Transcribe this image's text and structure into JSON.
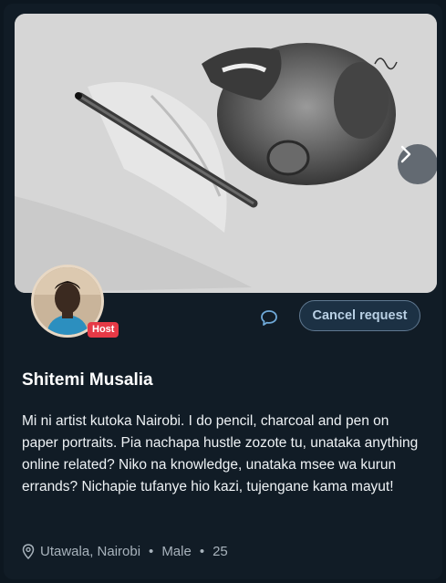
{
  "profile": {
    "name": "Shitemi Musalia",
    "host_badge": "Host",
    "bio": "Mi ni artist kutoka Nairobi. I do pencil, charcoal and pen on paper portraits. Pia nachapa hustle zozote tu, unataka anything online related? Niko na knowledge, unataka msee wa kurun errands? Nichapie tufanye hio kazi, tujengane kama mayut!",
    "location": "Utawala, Nairobi",
    "gender": "Male",
    "age": "25"
  },
  "actions": {
    "cancel_request_label": "Cancel request"
  },
  "icons": {
    "next": "chevron-right-icon",
    "chat": "chat-bubble-icon",
    "location": "location-pin-icon"
  },
  "colors": {
    "host_badge": "#e63946",
    "button_bg": "#1c3144",
    "button_text": "#b9d0e4"
  }
}
